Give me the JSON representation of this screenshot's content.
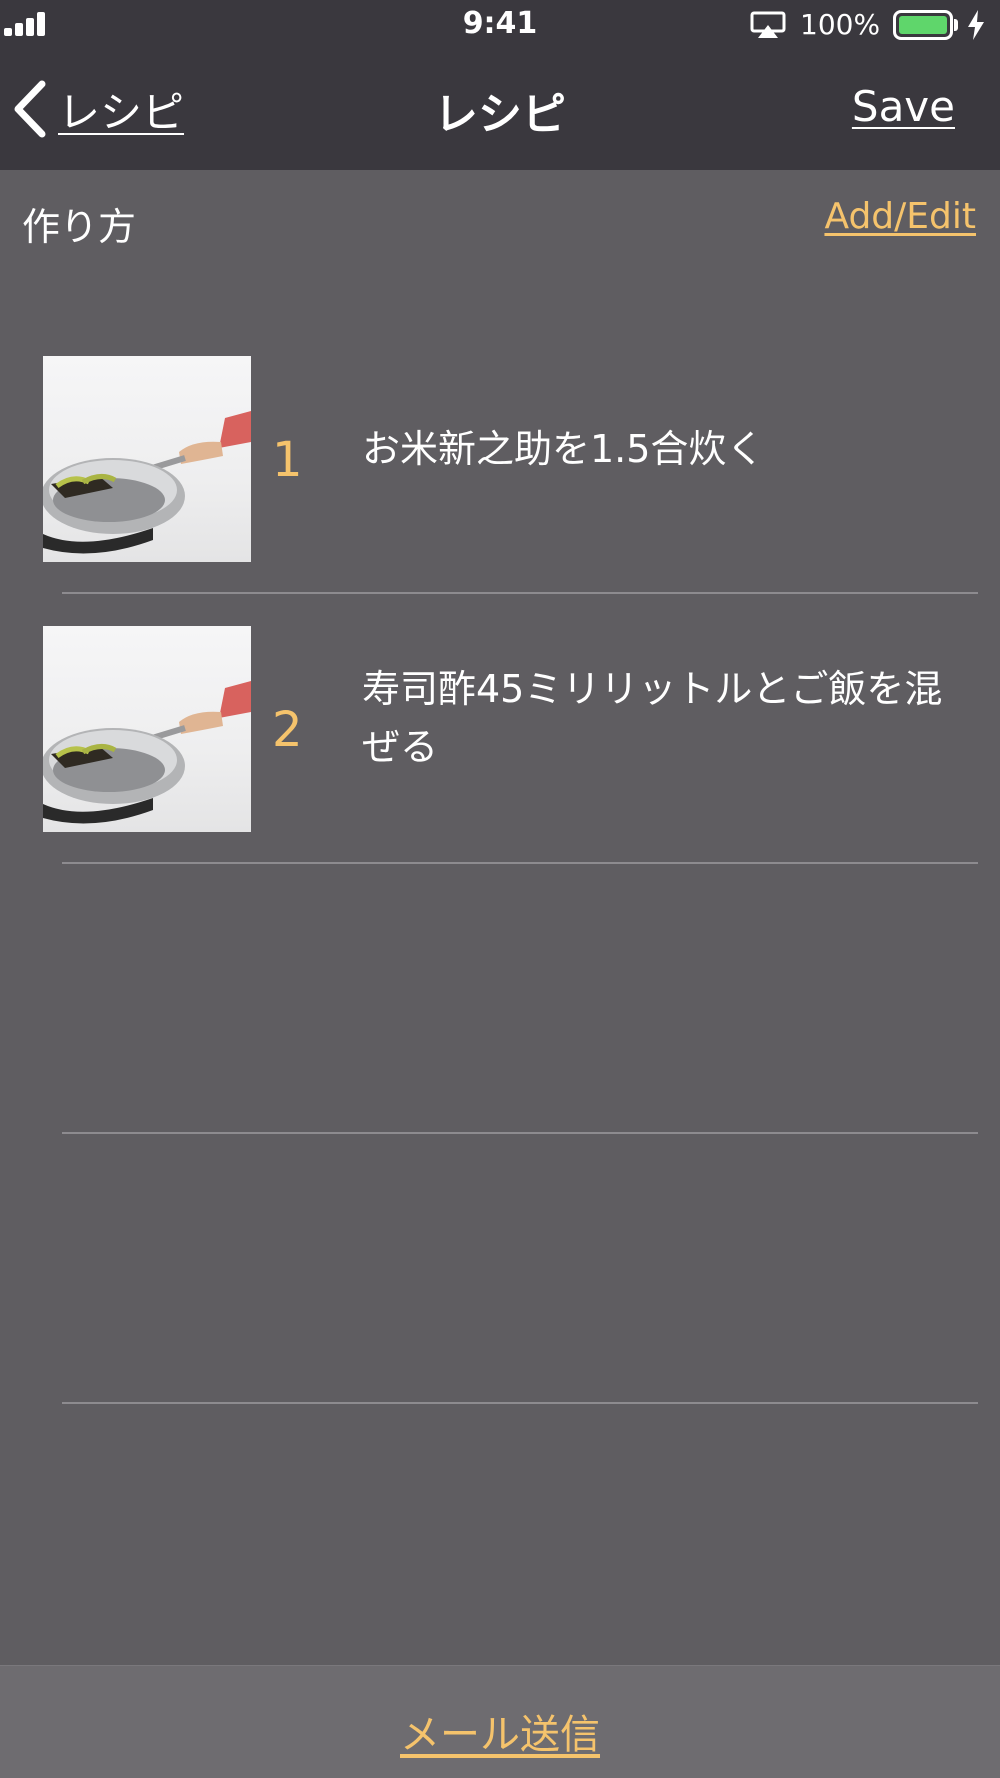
{
  "status_bar": {
    "time": "9:41",
    "battery_percent": "100%",
    "battery_level": 1.0,
    "battery_color": "#5fd66b",
    "icons": [
      "signal-icon",
      "airplay-icon",
      "battery-icon",
      "charging-bolt-icon"
    ]
  },
  "nav": {
    "back_label": "レシピ",
    "title": "レシピ",
    "save_label": "Save",
    "back_icon": "chevron-left-icon"
  },
  "section": {
    "title": "作り方",
    "add_edit_label": "Add/Edit"
  },
  "steps": [
    {
      "number": "1",
      "text": "お米新之助を1.5合炊く",
      "image": "frying-pan-photo"
    },
    {
      "number": "2",
      "text": "寿司酢45ミリリットルとご飯を混ぜる",
      "image": "frying-pan-photo"
    }
  ],
  "bottom": {
    "mail_label": "メール送信"
  },
  "colors": {
    "accent": "#f5c36c",
    "background": "#5f5d61",
    "bar": "#3a383e"
  }
}
